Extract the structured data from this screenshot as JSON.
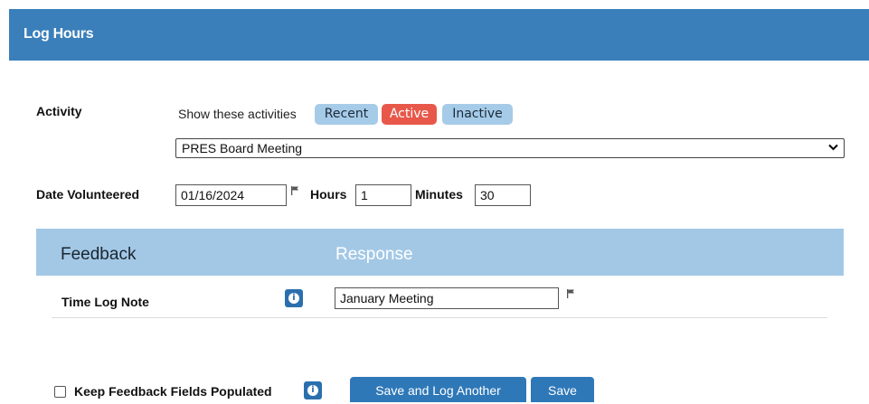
{
  "header": {
    "title": "Log Hours"
  },
  "activity": {
    "label": "Activity",
    "show_label": "Show these activities",
    "filters": [
      "Recent",
      "Active",
      "Inactive"
    ],
    "selected": "PRES Board Meeting"
  },
  "date_row": {
    "label": "Date Volunteered",
    "date_value": "01/16/2024",
    "hours_label": "Hours",
    "hours_value": "1",
    "minutes_label": "Minutes",
    "minutes_value": "30"
  },
  "feedback": {
    "col_feedback": "Feedback",
    "col_response": "Response",
    "rows": [
      {
        "label": "Time Log Note",
        "value": "January Meeting"
      }
    ]
  },
  "footer": {
    "keep_label": "Keep Feedback Fields Populated",
    "keep_checked": false,
    "save_another_label": "Save and Log Another",
    "save_label": "Save"
  },
  "colors": {
    "header": "#3a7fba",
    "pill_blue": "#a6cbe8",
    "pill_active": "#e8584a",
    "feedback_header": "#a3c8e6",
    "button": "#2f78b8"
  },
  "icons": [
    "info-icon",
    "flag-icon",
    "chevron-down-icon"
  ]
}
